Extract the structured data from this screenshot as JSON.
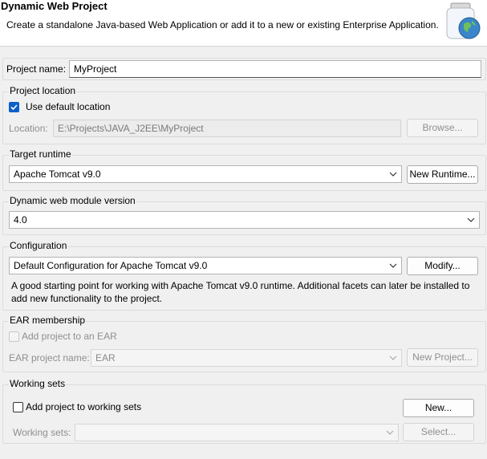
{
  "header": {
    "title": "Dynamic Web Project",
    "description": "Create a standalone Java-based Web Application or add it to a new or existing Enterprise Application."
  },
  "project": {
    "name_label": "Project name:",
    "name_value": "MyProject"
  },
  "location": {
    "group_label": "Project location",
    "use_default_label": "Use default location",
    "use_default_checked": true,
    "location_label": "Location:",
    "location_value": "E:\\Projects\\JAVA_J2EE\\MyProject",
    "browse_label": "Browse..."
  },
  "runtime": {
    "group_label": "Target runtime",
    "selected": "Apache Tomcat v9.0",
    "new_runtime_label": "New Runtime..."
  },
  "module": {
    "group_label": "Dynamic web module version",
    "selected": "4.0"
  },
  "configuration": {
    "group_label": "Configuration",
    "selected": "Default Configuration for Apache Tomcat v9.0",
    "modify_label": "Modify...",
    "description_line1": "A good starting point for working with Apache Tomcat v9.0 runtime. Additional facets can later be installed to",
    "description_line2": "add new functionality to the project."
  },
  "ear": {
    "group_label": "EAR membership",
    "add_label": "Add project to an EAR",
    "project_name_label": "EAR project name:",
    "project_name_value": "EAR",
    "new_project_label": "New Project..."
  },
  "working_sets": {
    "group_label": "Working sets",
    "add_label": "Add project to working sets",
    "new_label": "New...",
    "sets_label": "Working sets:",
    "sets_value": "",
    "select_label": "Select..."
  },
  "colors": {
    "accent": "#0a60c9",
    "background": "#f0f0f0"
  }
}
